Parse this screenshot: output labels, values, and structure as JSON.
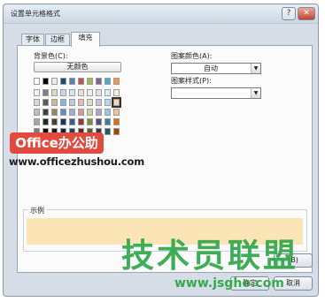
{
  "window": {
    "title": "设置单元格格式",
    "help_label": "?",
    "close_label": "✕"
  },
  "tabs": [
    {
      "label": "字体",
      "active": false
    },
    {
      "label": "边框",
      "active": false
    },
    {
      "label": "填充",
      "active": true
    }
  ],
  "fill": {
    "background_color_label": "背景色(C):",
    "no_color_label": "无颜色",
    "pattern_color_label": "图案颜色(A):",
    "pattern_color_value": "自动",
    "pattern_style_label": "图案样式(P):",
    "pattern_style_value": "",
    "sample_label": "示例",
    "sample_color": "#fbe5b6"
  },
  "palette": {
    "theme_rows": [
      [
        "#ffffff",
        "#000000",
        "#eeece1",
        "#1f497d",
        "#4f81bd",
        "#c0504d",
        "#9bbb59",
        "#8064a2",
        "#4bacc6",
        "#f79646"
      ],
      [
        "#f2f2f2",
        "#7f7f7f",
        "#ddd9c3",
        "#c6d9f0",
        "#dbe5f1",
        "#f2dcdb",
        "#ebf1dd",
        "#e5e0ec",
        "#dbeef3",
        "#fdeada"
      ],
      [
        "#d8d8d8",
        "#595959",
        "#c4bd97",
        "#8db3e2",
        "#b8cce4",
        "#e5b9b7",
        "#d7e3bc",
        "#ccc1d9",
        "#b7dde8",
        "#fbd5b5"
      ],
      [
        "#bfbfbf",
        "#3f3f3f",
        "#938953",
        "#548dd4",
        "#95b3d7",
        "#d99694",
        "#c3d69b",
        "#b2a2c7",
        "#92cddc",
        "#fac08f"
      ],
      [
        "#a5a5a5",
        "#262626",
        "#494429",
        "#17365d",
        "#366092",
        "#953734",
        "#76923c",
        "#5f497a",
        "#31859b",
        "#e36c09"
      ],
      [
        "#7f7f7f",
        "#0c0c0c",
        "#1d1b10",
        "#0f243e",
        "#244061",
        "#632423",
        "#4f6128",
        "#3f3151",
        "#205867",
        "#974806"
      ]
    ],
    "selected": "#fbd5b5"
  },
  "watermarks": {
    "badge_text": "Office办公助手",
    "url_text": "www.officezhushou.com",
    "green_text": "技术员联盟",
    "green_url": "www.jsgho.com"
  },
  "buttons": {
    "ok_label": "确定",
    "cancel_label": "取消",
    "fill_effect_label": "(B)"
  }
}
